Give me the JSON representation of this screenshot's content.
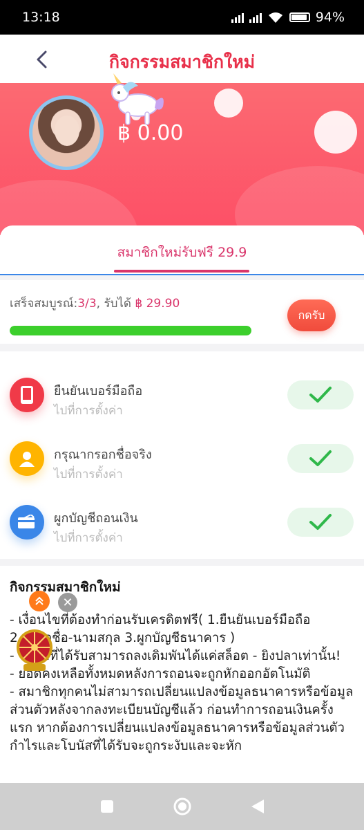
{
  "status": {
    "time": "13:18",
    "battery": "94%"
  },
  "header": {
    "title": "กิจกรรมสมาชิกใหม่"
  },
  "hero": {
    "balance": "฿ 0.00"
  },
  "tab": {
    "label": "สมาชิกใหม่รับฟรี 29.9"
  },
  "progress": {
    "label_prefix": "เสร็จสมบูรณ์:",
    "count": "3/3",
    "label_mid": ", รับได้ ",
    "reward": "฿ 29.90",
    "fraction": 1.0,
    "claim_label": "กดรับ"
  },
  "tasks": [
    {
      "title": "ยืนยันเบอร์มือถือ",
      "subtitle": "ไปที่การตั้งค่า",
      "icon": "phone-icon",
      "color": "#f03a48"
    },
    {
      "title": "กรุณากรอกชื่อจริง",
      "subtitle": "ไปที่การตั้งค่า",
      "icon": "user-icon",
      "color": "#ffb400"
    },
    {
      "title": "ผูกบัญชีถอนเงิน",
      "subtitle": "ไปที่การตั้งค่า",
      "icon": "card-icon",
      "color": "#3a86e8"
    }
  ],
  "info": {
    "title": "กิจกรรมสมาชิกใหม่",
    "lines": [
      "- เงื่อนไขที่ต้องทำก่อนรับเครดิตฟรี( 1.ยืนยันเบอร์มือถือ 2.กรอกชื่อ-นามสกุล 3.ผูกบัญชีธนาคาร )",
      "- โบนัสที่ได้รับสามารถลงเดิมพันได้แค่สล็อต - ยิงปลาเท่านั้น!",
      "- ยอดคงเหลือทั้งหมดหลังการถอนจะถูกหักออกอัตโนมัติ",
      "- สมาชิกทุกคนไม่สามารถเปลี่ยนแปลงข้อมูลธนาคารหรือข้อมูลส่วนตัวหลังจากลงทะเบียนบัญชีแล้ว ก่อนทำการถอนเงินครั้งแรก หากต้องการเปลี่ยนแปลงข้อมูลธนาคารหรือข้อมูลส่วนตัว กำไรและโบนัสที่ได้รับจะถูกระงับและจะหัก"
    ]
  },
  "colors": {
    "accent": "#e8304a",
    "tab": "#d9346a",
    "progress": "#3ccf2c",
    "check": "#2fb84a"
  }
}
